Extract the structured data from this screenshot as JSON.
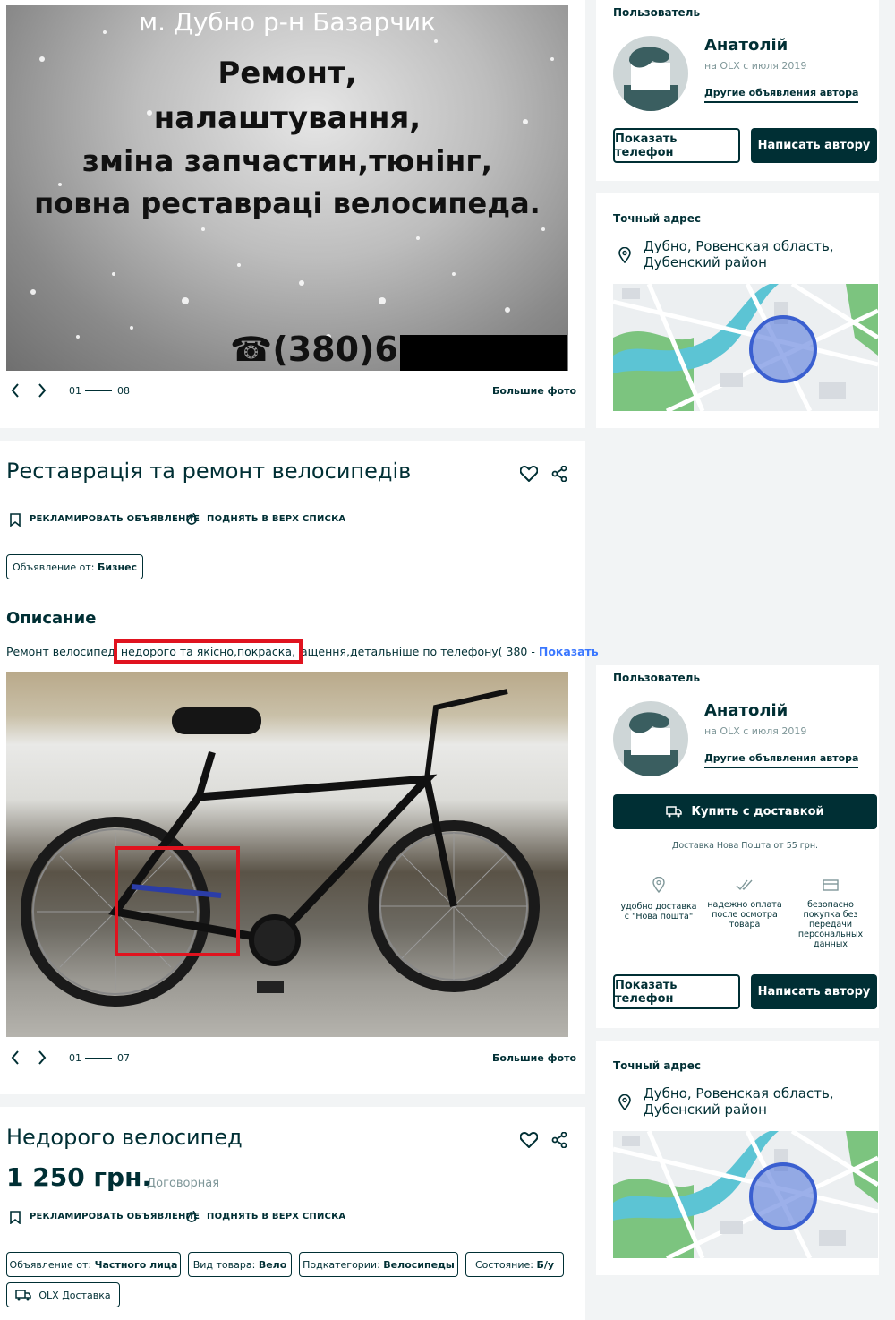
{
  "listing1": {
    "photo": {
      "lines": [
        "м. Дубно р-н Базарчик",
        "Ремонт,",
        "налаштування,",
        "зміна запчастин,тюнінг,",
        "повна реставраці велосипеда."
      ],
      "phone": "☎(380)63"
    },
    "gallery": {
      "current": "01",
      "total": "08",
      "more": "Большие фото"
    },
    "title": "Реставрація та ремонт велосипедів",
    "actions": {
      "promote": "РЕКЛАМИРОВАТЬ ОБЪЯВЛЕНИЕ",
      "raise": "ПОДНЯТЬ В ВЕРХ СПИСКА"
    },
    "tag": {
      "label": "Объявление от:",
      "value": "Бизнес"
    },
    "description": {
      "heading": "Описание",
      "text_before": "Ремонт велосипед",
      "text_highlight": "недорого та якісно,покраска,",
      "text_after": "ащення,детальніше по телефону( 380 -",
      "show": "Показать"
    }
  },
  "listing2": {
    "gallery": {
      "current": "01",
      "total": "07",
      "more": "Большие фото"
    },
    "title": "Недорого велосипед",
    "price": "1 250 грн.",
    "negotiable": "Договорная",
    "actions": {
      "promote": "РЕКЛАМИРОВАТЬ ОБЪЯВЛЕНИЕ",
      "raise": "ПОДНЯТЬ В ВЕРХ СПИСКА"
    },
    "tags": [
      {
        "label": "Объявление от:",
        "value": "Частного лица"
      },
      {
        "label": "Вид товара:",
        "value": "Вело"
      },
      {
        "label": "Подкатегории:",
        "value": "Велосипеды"
      },
      {
        "label": "Состояние:",
        "value": "Б/у"
      }
    ],
    "delivery_tag": "OLX Доставка"
  },
  "seller1": {
    "section_label": "Пользователь",
    "name": "Анатолій",
    "since": "на OLX с июля 2019",
    "other_ads": "Другие объявления автора",
    "show_phone": "Показать телефон",
    "write": "Написать автору"
  },
  "address1": {
    "label": "Точный адрес",
    "line1": "Дубно, Ровенская область,",
    "line2": "Дубенский район"
  },
  "seller2": {
    "section_label": "Пользователь",
    "name": "Анатолій",
    "since": "на OLX с июля 2019",
    "other_ads": "Другие объявления автора",
    "buy_delivery": "Купить с доставкой",
    "delivery_note": "Доставка Нова Пошта от 55 грн.",
    "features": [
      {
        "icon": "location-pin-icon",
        "text": "удобно доставка с \"Нова пошта\""
      },
      {
        "icon": "double-check-icon",
        "text": "надежно оплата после осмотра товара"
      },
      {
        "icon": "credit-card-icon",
        "text": "безопасно покупка без передачи персональных данных"
      }
    ],
    "show_phone": "Показать телефон",
    "write": "Написать автору"
  },
  "address2": {
    "label": "Точный адрес",
    "line1": "Дубно, Ровенская область,",
    "line2": "Дубенский район"
  },
  "colors": {
    "primary": "#002f34",
    "link": "#3a77ff",
    "highlight": "#e0131f",
    "background": "#f2f4f5"
  }
}
